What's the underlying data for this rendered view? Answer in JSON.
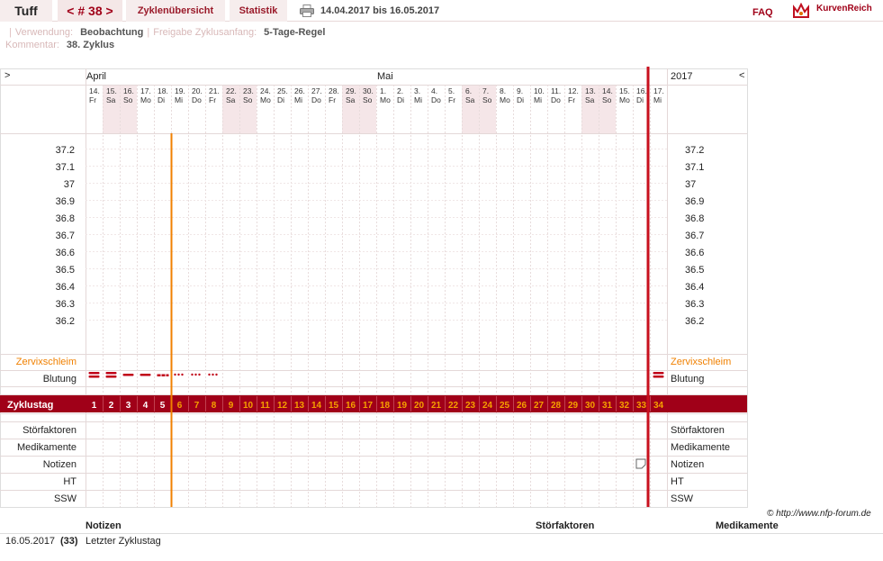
{
  "header": {
    "name": "Tuff",
    "cycle": "< # 38 >",
    "overview_tab": "Zyklenübersicht",
    "stats_tab": "Statistik",
    "date_range": "14.04.2017 bis 16.05.2017",
    "faq": "FAQ",
    "brand": "KurvenReich"
  },
  "info": {
    "usage_label": "Verwendung:",
    "usage_value": "Beobachtung",
    "release_label": "Freigabe Zyklusanfang:",
    "release_value": "5-Tage-Regel",
    "comment_label": "Kommentar:",
    "comment_value": "38. Zyklus"
  },
  "chart_data": {
    "nav_left": ">",
    "nav_right": "<",
    "year": "2017",
    "months": [
      {
        "label": "April",
        "start_index": 0
      },
      {
        "label": "Mai",
        "start_index": 17
      }
    ],
    "days": [
      {
        "d": "14.",
        "w": "Fr"
      },
      {
        "d": "15.",
        "w": "Sa"
      },
      {
        "d": "16.",
        "w": "So"
      },
      {
        "d": "17.",
        "w": "Mo"
      },
      {
        "d": "18.",
        "w": "Di"
      },
      {
        "d": "19.",
        "w": "Mi"
      },
      {
        "d": "20.",
        "w": "Do"
      },
      {
        "d": "21.",
        "w": "Fr"
      },
      {
        "d": "22.",
        "w": "Sa"
      },
      {
        "d": "23.",
        "w": "So"
      },
      {
        "d": "24.",
        "w": "Mo"
      },
      {
        "d": "25.",
        "w": "Di"
      },
      {
        "d": "26.",
        "w": "Mi"
      },
      {
        "d": "27.",
        "w": "Do"
      },
      {
        "d": "28.",
        "w": "Fr"
      },
      {
        "d": "29.",
        "w": "Sa"
      },
      {
        "d": "30.",
        "w": "So"
      },
      {
        "d": "1.",
        "w": "Mo"
      },
      {
        "d": "2.",
        "w": "Di"
      },
      {
        "d": "3.",
        "w": "Mi"
      },
      {
        "d": "4.",
        "w": "Do"
      },
      {
        "d": "5.",
        "w": "Fr"
      },
      {
        "d": "6.",
        "w": "Sa"
      },
      {
        "d": "7.",
        "w": "So"
      },
      {
        "d": "8.",
        "w": "Mo"
      },
      {
        "d": "9.",
        "w": "Di"
      },
      {
        "d": "10.",
        "w": "Mi"
      },
      {
        "d": "11.",
        "w": "Do"
      },
      {
        "d": "12.",
        "w": "Fr"
      },
      {
        "d": "13.",
        "w": "Sa"
      },
      {
        "d": "14.",
        "w": "So"
      },
      {
        "d": "15.",
        "w": "Mo"
      },
      {
        "d": "16.",
        "w": "Di"
      },
      {
        "d": "17.",
        "w": "Mi"
      }
    ],
    "temperature_ticks": [
      "37.2",
      "37.1",
      "37",
      "36.9",
      "36.8",
      "36.7",
      "36.6",
      "36.5",
      "36.4",
      "36.3",
      "36.2"
    ],
    "row_labels": {
      "cervical": "Zervixschleim",
      "bleeding": "Blutung",
      "cycle_day": "Zyklustag",
      "disturbances": "Störfaktoren",
      "medication": "Medikamente",
      "notes": "Notizen",
      "ht": "HT",
      "ssw": "SSW"
    },
    "cycle_days": [
      "1",
      "2",
      "3",
      "4",
      "5",
      "6",
      "7",
      "8",
      "9",
      "10",
      "11",
      "12",
      "13",
      "14",
      "15",
      "16",
      "17",
      "18",
      "19",
      "20",
      "21",
      "22",
      "23",
      "24",
      "25",
      "26",
      "27",
      "28",
      "29",
      "30",
      "31",
      "32",
      "33",
      "34"
    ],
    "bleeding": [
      "heavy",
      "heavy",
      "medium",
      "medium",
      "light",
      "spotting",
      "spotting",
      "spotting",
      "",
      "",
      "",
      "",
      "",
      "",
      "",
      "",
      "",
      "",
      "",
      "",
      "",
      "",
      "",
      "",
      "",
      "",
      "",
      "",
      "",
      "",
      "",
      "",
      "",
      "heavy"
    ],
    "release_after_cycle_day": 5,
    "current_day_index": 33,
    "note_icon_day_index": 32,
    "colors": {
      "accent": "#a00018",
      "orange": "#f08000",
      "weekend": "#f5e6e8",
      "cycle_bar": "#a00018",
      "cycle_num": "#f5a000"
    }
  },
  "copyright": "© http://www.nfp-forum.de",
  "bottom": {
    "headers": {
      "notes": "Notizen",
      "disturbances": "Störfaktoren",
      "medication": "Medikamente"
    },
    "rows": [
      {
        "date": "16.05.2017",
        "day": "(33)",
        "note": "Letzter Zyklustag"
      }
    ]
  }
}
